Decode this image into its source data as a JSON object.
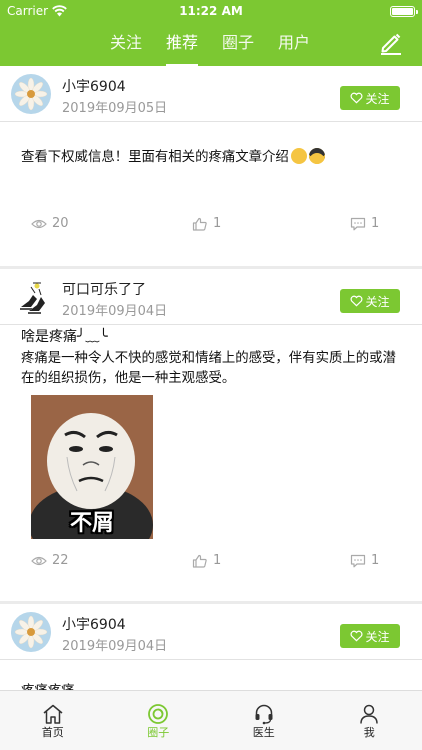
{
  "status": {
    "carrier": "Carrier",
    "time": "11:22 AM"
  },
  "tabs": [
    {
      "label": "关注"
    },
    {
      "label": "推荐"
    },
    {
      "label": "圈子"
    },
    {
      "label": "用户"
    }
  ],
  "posts": [
    {
      "username": "小宇6904",
      "date": "2019年09月05日",
      "follow_label": "关注",
      "text": "查看下权威信息！里面有相关的疼痛文章介绍",
      "views": "20",
      "likes": "1",
      "comments": "1"
    },
    {
      "username": "可口可乐了了",
      "date": "2019年09月04日",
      "follow_label": "关注",
      "title": "啥是疼痛╯﹏╰",
      "text": "疼痛是一种令人不快的感觉和情绪上的感受，伴有实质上的或潜在的组织损伤，他是一种主观感受。",
      "image_caption": "不屑",
      "views": "22",
      "likes": "1",
      "comments": "1"
    },
    {
      "username": "小宇6904",
      "date": "2019年09月04日",
      "follow_label": "关注",
      "text": "疼痛疼痛"
    }
  ],
  "bottom_nav": [
    {
      "label": "首页",
      "icon": "home-icon"
    },
    {
      "label": "圈子",
      "icon": "circle-icon"
    },
    {
      "label": "医生",
      "icon": "headset-icon"
    },
    {
      "label": "我",
      "icon": "user-icon"
    }
  ],
  "colors": {
    "accent": "#7cc832",
    "background": "#ebebeb"
  }
}
